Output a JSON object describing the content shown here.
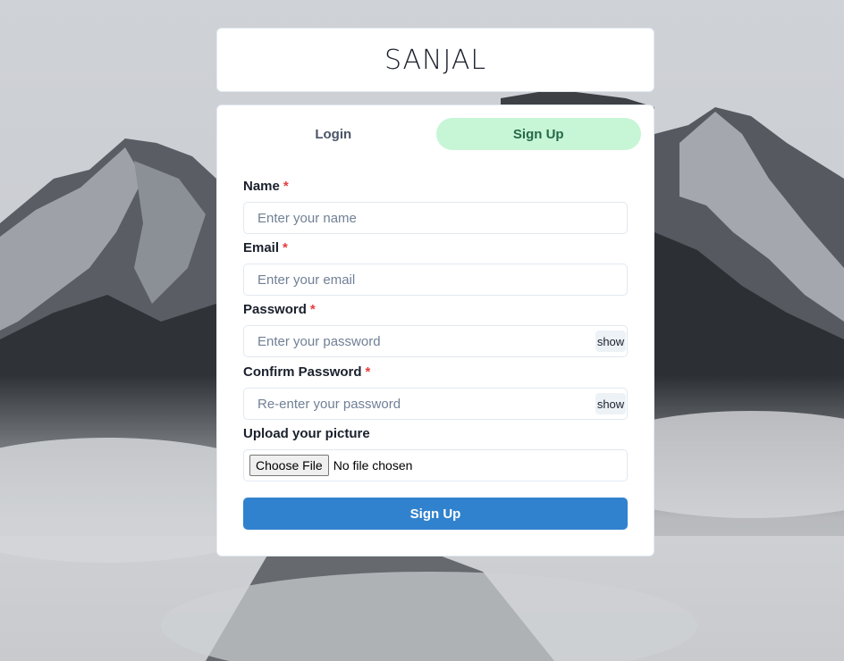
{
  "app": {
    "title": "SANJAL"
  },
  "tabs": [
    {
      "label": "Login",
      "active": false
    },
    {
      "label": "Sign Up",
      "active": true
    }
  ],
  "form": {
    "required_mark": "*",
    "name": {
      "label": "Name",
      "placeholder": "Enter your name",
      "value": ""
    },
    "email": {
      "label": "Email",
      "placeholder": "Enter your email",
      "value": ""
    },
    "password": {
      "label": "Password",
      "placeholder": "Enter your password",
      "value": "",
      "toggle_label": "show"
    },
    "confirm_password": {
      "label": "Confirm Password",
      "placeholder": "Re-enter your password",
      "value": "",
      "toggle_label": "show"
    },
    "picture": {
      "label": "Upload your picture",
      "button_label": "Choose File",
      "status": "No file chosen"
    },
    "submit_label": "Sign Up"
  },
  "colors": {
    "active_tab_bg": "#c6f6d5",
    "active_tab_text": "#276749",
    "primary_button": "#3182ce",
    "required": "#e53e3e"
  },
  "background": {
    "icon": "mountain-landscape-image"
  }
}
